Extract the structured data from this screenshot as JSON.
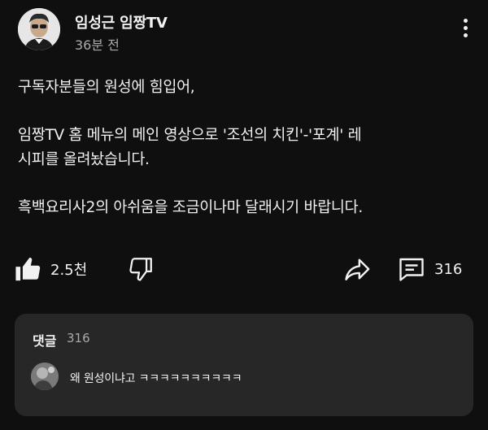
{
  "post": {
    "channel_name": "임성근 임짱TV",
    "time": "36분 전",
    "body": {
      "line1": "구독자분들의 원성에 힘입어,",
      "line2": "임짱TV 홈 메뉴의 메인 영상으로 '조선의 치킨'-'포계' 레",
      "line3": "시피를 올려놨습니다.",
      "line4": "흑백요리사2의 아쉬움을 조금이나마 달래시기 바랍니다."
    }
  },
  "actions": {
    "like_count": "2.5천",
    "comment_count": "316"
  },
  "comments": {
    "title": "댓글",
    "count": "316",
    "preview_text": "왜 원성이냐고 ㅋㅋㅋㅋㅋㅋㅋㅋㅋㅋ"
  },
  "icons": {
    "more": "more-vertical-icon",
    "like": "thumbs-up-filled-icon",
    "dislike": "thumbs-down-outline-icon",
    "share": "share-arrow-icon",
    "comment": "comment-icon"
  },
  "colors": {
    "background": "#0f0f0f",
    "card": "#272727",
    "text": "#f1f1f1",
    "secondary_text": "#aaaaaa"
  }
}
